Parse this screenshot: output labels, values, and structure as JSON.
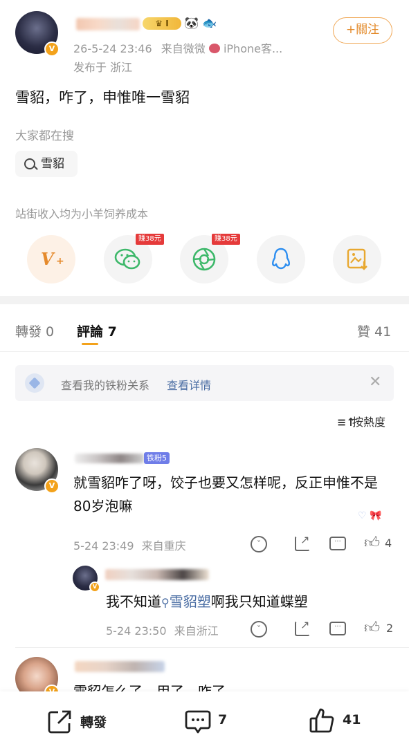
{
  "post": {
    "time": "26-5-24 23:46",
    "source_prefix": "来自",
    "source": "微微",
    "client": "iPhone客...",
    "location": "发布于 浙江",
    "follow_label": "+關注",
    "level_badge": "I",
    "text": "雪貂，咋了，申惟唯一雪貂"
  },
  "trending": {
    "title": "大家都在搜",
    "chip": "雪貂"
  },
  "share": {
    "title": "站街收入均为小羊饲养成本",
    "earn_wechat": "赚38元",
    "earn_moments": "赚38元"
  },
  "tabs": {
    "repost": "轉發 0",
    "comment": "評論 7",
    "like": "贊 41"
  },
  "fans": {
    "text": "查看我的铁粉关系",
    "link": "查看详情"
  },
  "sort_label": "按熱度",
  "comments": [
    {
      "fan_badge": "铁粉5",
      "text": "就雪貂咋了呀，饺子也要又怎样呢，反正申惟不是80岁泡嘛",
      "time": "5-24 23:49",
      "location": "来自重庆",
      "likes": "4"
    },
    {
      "text_pre": "我不知道",
      "link": "雪貂塑",
      "text_post": "啊我只知道蝶塑",
      "time": "5-24 23:50",
      "location": "来自浙江",
      "likes": "2"
    },
    {
      "text": "雪貂怎么了，用了，咋了"
    }
  ],
  "bottom": {
    "repost": "轉發",
    "comments": "7",
    "likes": "41"
  },
  "colors": {
    "accent_orange": "#f3a21b",
    "link_blue": "#4a6da3",
    "wechat_green": "#3db86a",
    "qq_blue": "#2d8ef0",
    "earn_red": "#e53a3a"
  }
}
